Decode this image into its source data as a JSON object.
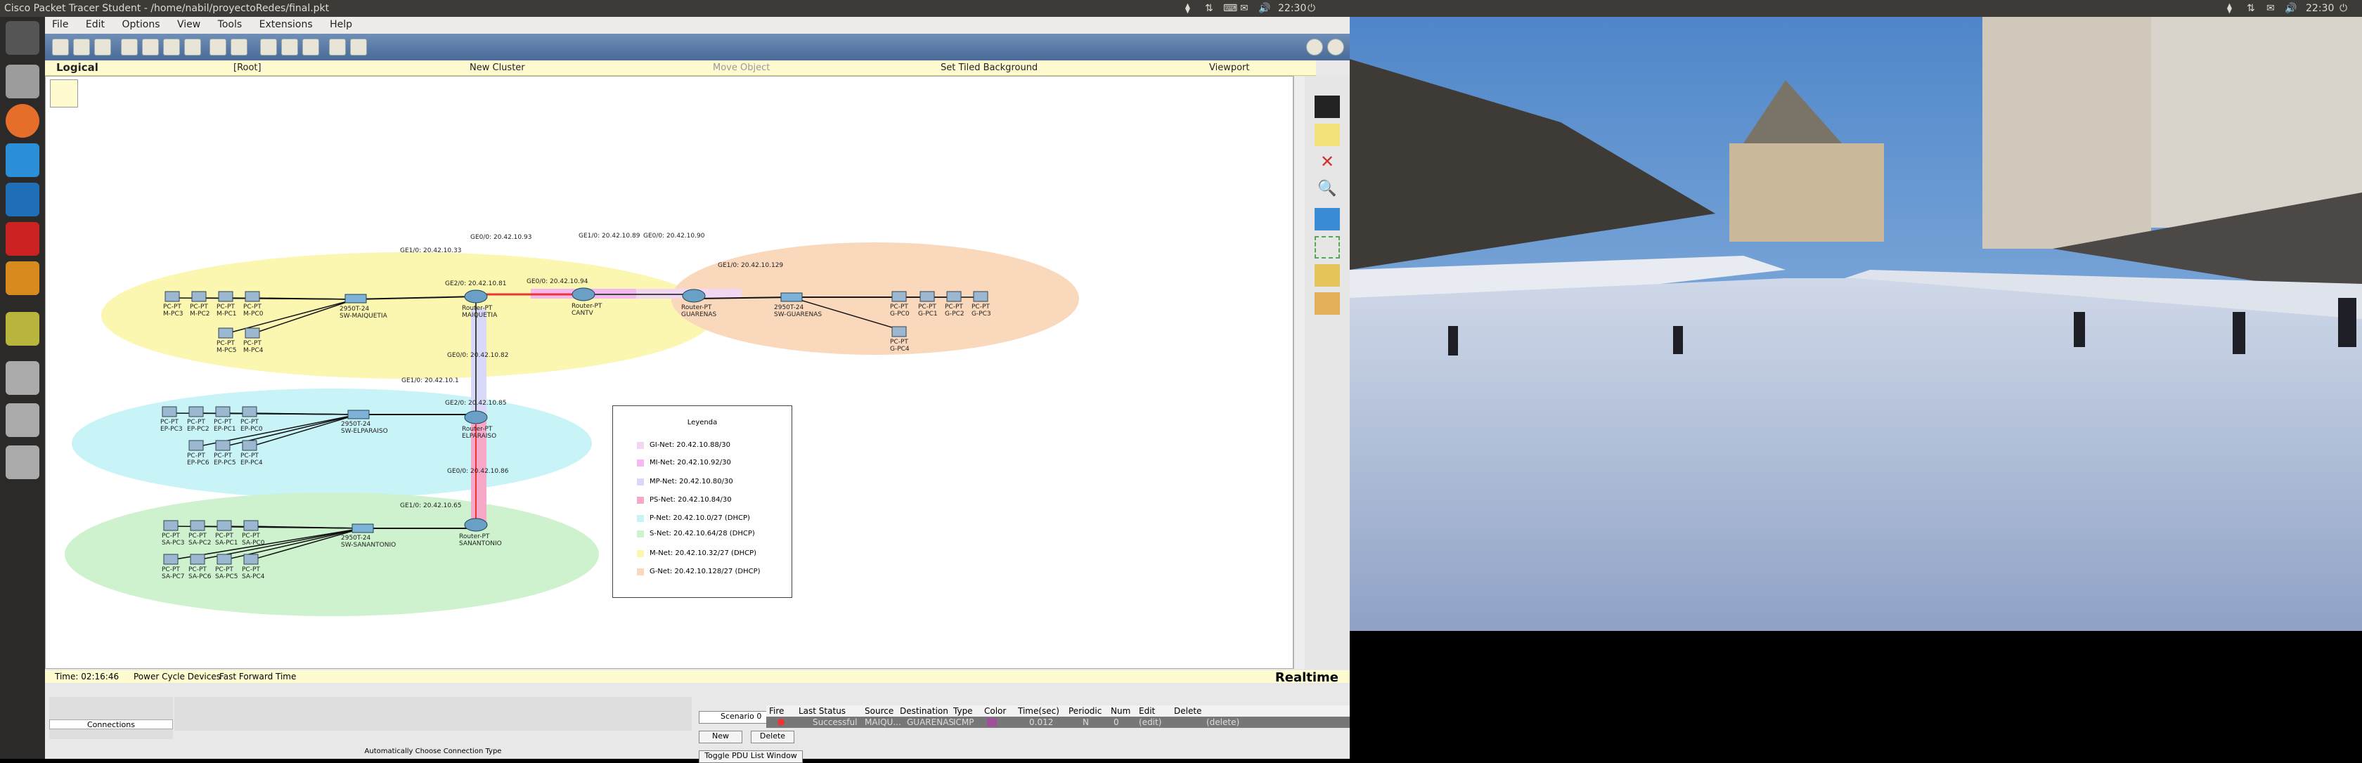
{
  "window_title": "Cisco Packet Tracer Student - /home/nabil/proyectoRedes/final.pkt",
  "clock_left": "22:30",
  "clock_right": "22:30",
  "menu": [
    "File",
    "Edit",
    "Options",
    "View",
    "Tools",
    "Extensions",
    "Help"
  ],
  "logical_bar": {
    "mode": "Logical",
    "root": "[Root]",
    "new_cluster": "New Cluster",
    "move_object": "Move Object",
    "tiled_bg": "Set Tiled Background",
    "viewport": "Viewport"
  },
  "status": {
    "time": "Time: 02:16:46",
    "power": "Power Cycle Devices",
    "fast": "Fast Forward Time",
    "realtime": "Realtime"
  },
  "bottom": {
    "connections": "Connections",
    "auto_conn": "Automatically Choose Connection Type",
    "scenario": "Scenario 0",
    "new": "New",
    "delete": "Delete",
    "toggle_pdu": "Toggle PDU List Window"
  },
  "pdu_headers": [
    "Fire",
    "Last Status",
    "Source",
    "Destination",
    "Type",
    "Color",
    "Time(sec)",
    "Periodic",
    "Num",
    "Edit",
    "Delete"
  ],
  "pdu_row": {
    "status": "Successful",
    "source": "MAIQU...",
    "destination": "GUARENAS",
    "type": "ICMP",
    "time": "0.012",
    "periodic": "N",
    "num": "0",
    "edit": "(edit)",
    "delete": "(delete)"
  },
  "devices": {
    "maiq_pcs": [
      "PC-PT\nM-PC3",
      "PC-PT\nM-PC2",
      "PC-PT\nM-PC1",
      "PC-PT\nM-PC0",
      "PC-PT\nM-PC5",
      "PC-PT\nM-PC4"
    ],
    "sw_maiq": "2950T-24\nSW-MAIQUETIA",
    "r_maiq": "Router-PT\nMAIQUETIA",
    "r_cantv": "Router-PT\nCANTV",
    "r_guar": "Router-PT\nGUARENAS",
    "sw_guar": "2950T-24\nSW-GUARENAS",
    "guar_pcs": [
      "PC-PT\nG-PC0",
      "PC-PT\nG-PC1",
      "PC-PT\nG-PC2",
      "PC-PT\nG-PC3",
      "PC-PT\nG-PC4"
    ],
    "ep_pcs": [
      "PC-PT\nEP-PC3",
      "PC-PT\nEP-PC2",
      "PC-PT\nEP-PC1",
      "PC-PT\nEP-PC0",
      "PC-PT\nEP-PC6",
      "PC-PT\nEP-PC5",
      "PC-PT\nEP-PC4"
    ],
    "sw_ep": "2950T-24\nSW-ELPARAISO",
    "r_ep": "Router-PT\nELPARAISO",
    "sa_pcs": [
      "PC-PT\nSA-PC3",
      "PC-PT\nSA-PC2",
      "PC-PT\nSA-PC1",
      "PC-PT\nSA-PC0",
      "PC-PT\nSA-PC7",
      "PC-PT\nSA-PC6",
      "PC-PT\nSA-PC5",
      "PC-PT\nSA-PC4"
    ],
    "sw_sa": "2950T-24\nSW-SANANTONIO",
    "r_sa": "Router-PT\nSANANTONIO"
  },
  "ip_labels": {
    "m_ge1": "GE1/0: 20.42.10.33",
    "m_ge0": "GE0/0: 20.42.10.93",
    "m_ge2": "GE2/0: 20.42.10.81",
    "c_ge0": "GE0/0: 20.42.10.94",
    "c_ge1": "GE1/0: 20.42.10.89",
    "g_ge0": "GE0/0: 20.42.10.90",
    "g_ge1": "GE1/0: 20.42.10.129",
    "e_ge0": "GE0/0: 20.42.10.82",
    "e_ge1": "GE1/0: 20.42.10.1",
    "e_ge2": "GE2/0: 20.42.10.85",
    "s_ge0": "GE0/0: 20.42.10.86",
    "s_ge1": "GE1/0: 20.42.10.65"
  },
  "legend": {
    "title": "Leyenda",
    "rows": [
      {
        "text": "GI-Net: 20.42.10.88/30",
        "color": "#f2d7f2"
      },
      {
        "text": "MI-Net: 20.42.10.92/30",
        "color": "#f5b8f0"
      },
      {
        "text": "MP-Net: 20.42.10.80/30",
        "color": "#d8d8f8"
      },
      {
        "text": "PS-Net: 20.42.10.84/30",
        "color": "#f7a8c8"
      },
      {
        "text": "P-Net: 20.42.10.0/27 (DHCP)",
        "color": "#c8f4f8"
      },
      {
        "text": "S-Net: 20.42.10.64/28 (DHCP)",
        "color": "#cdf2cd"
      },
      {
        "text": "M-Net: 20.42.10.32/27 (DHCP)",
        "color": "#fbf6b0"
      },
      {
        "text": "G-Net: 20.42.10.128/27 (DHCP)",
        "color": "#f9d8bc"
      }
    ]
  }
}
